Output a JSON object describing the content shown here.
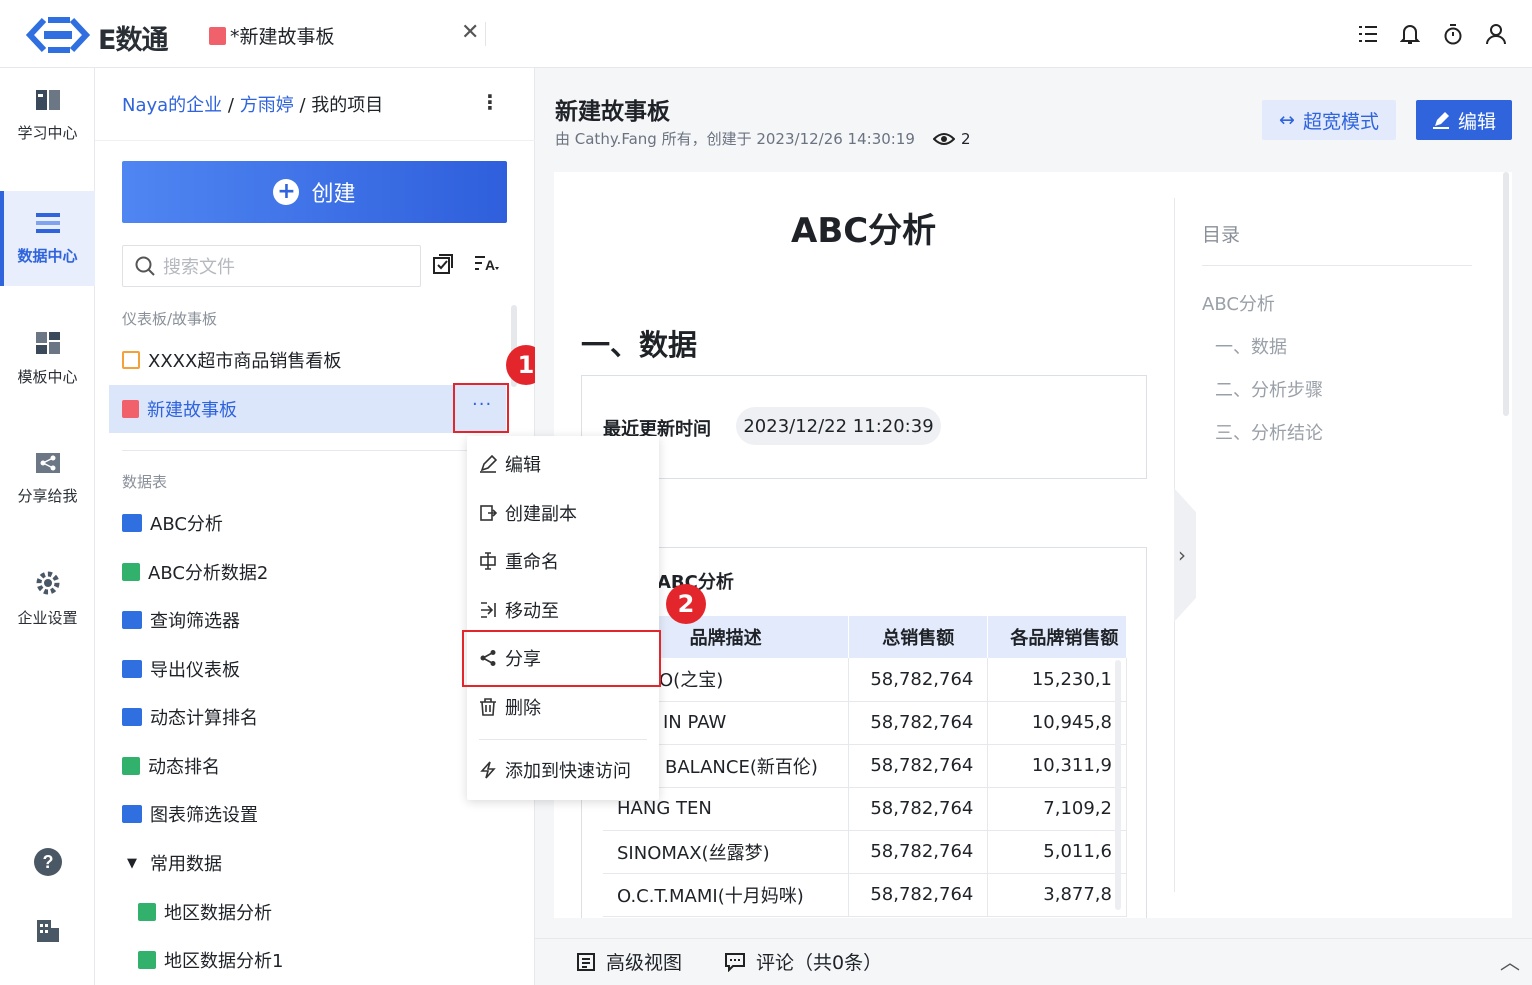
{
  "app": {
    "name": "E数通",
    "brand_color": "#2f64dc"
  },
  "tab": {
    "title": "*新建故事板"
  },
  "top_icons": [
    "list-icon",
    "bell-icon",
    "timer-icon",
    "user-icon"
  ],
  "nav": [
    {
      "label": "学习中心",
      "icon": "book-icon"
    },
    {
      "label": "数据中心",
      "icon": "data-icon",
      "active": true
    },
    {
      "label": "模板中心",
      "icon": "template-icon"
    },
    {
      "label": "分享给我",
      "icon": "share-icon"
    },
    {
      "label": "企业设置",
      "icon": "gear-icon"
    }
  ],
  "breadcrumb": {
    "org": "Naya的企业",
    "user": "方雨婷",
    "sep": "/",
    "project": "我的项目"
  },
  "create_label": "创建",
  "search_placeholder": "搜索文件",
  "sections": {
    "dash": "仪表板/故事板",
    "tables": "数据表"
  },
  "dash_items": [
    {
      "label": "XXXX超市商品销售看板",
      "type": "dashboard"
    },
    {
      "label": "新建故事板",
      "type": "story",
      "selected": true
    }
  ],
  "table_items": [
    {
      "label": "ABC分析",
      "type": "chart"
    },
    {
      "label": "ABC分析数据2",
      "type": "table"
    },
    {
      "label": "查询筛选器",
      "type": "chart"
    },
    {
      "label": "导出仪表板",
      "type": "chart"
    },
    {
      "label": "动态计算排名",
      "type": "chart"
    },
    {
      "label": "动态排名",
      "type": "table"
    },
    {
      "label": "图表筛选设置",
      "type": "chart"
    }
  ],
  "folder": {
    "label": "常用数据",
    "items": [
      "地区数据分析",
      "地区数据分析1"
    ]
  },
  "more_label": "···",
  "menu": [
    "编辑",
    "创建副本",
    "重命名",
    "移动至",
    "分享",
    "删除",
    "添加到快速访问"
  ],
  "badges": [
    "1",
    "2"
  ],
  "doc": {
    "title": "新建故事板",
    "meta": "由 Cathy.Fang 所有，创建于 2023/12/26 14:30:19",
    "views": "2",
    "wide_label": "超宽模式",
    "edit_label": "编辑",
    "h1": "ABC分析",
    "h2": "一、数据",
    "update_label": "最近更新时间",
    "update_value": "2023/12/22 11:20:39",
    "table_title": "ABC分析",
    "table_headers": [
      "品牌描述",
      "总销售额",
      "各品牌销售额"
    ],
    "table_rows": [
      [
        "O(之宝)",
        "58,782,764",
        "15,230,1"
      ],
      [
        "IN PAW",
        "58,782,764",
        "10,945,8"
      ],
      [
        "BALANCE(新百伦)",
        "58,782,764",
        "10,311,9"
      ],
      [
        "HANG TEN",
        "58,782,764",
        "7,109,2"
      ],
      [
        "SINOMAX(丝露梦)",
        "58,782,764",
        "5,011,6"
      ],
      [
        "O.C.T.MAMI(十月妈咪)",
        "58,782,764",
        "3,877,8"
      ]
    ]
  },
  "toc": {
    "title": "目录",
    "items": [
      "ABC分析",
      "一、数据",
      "二、分析步骤",
      "三、分析结论"
    ]
  },
  "bottom": {
    "advanced": "高级视图",
    "comments": "评论（共0条）"
  }
}
